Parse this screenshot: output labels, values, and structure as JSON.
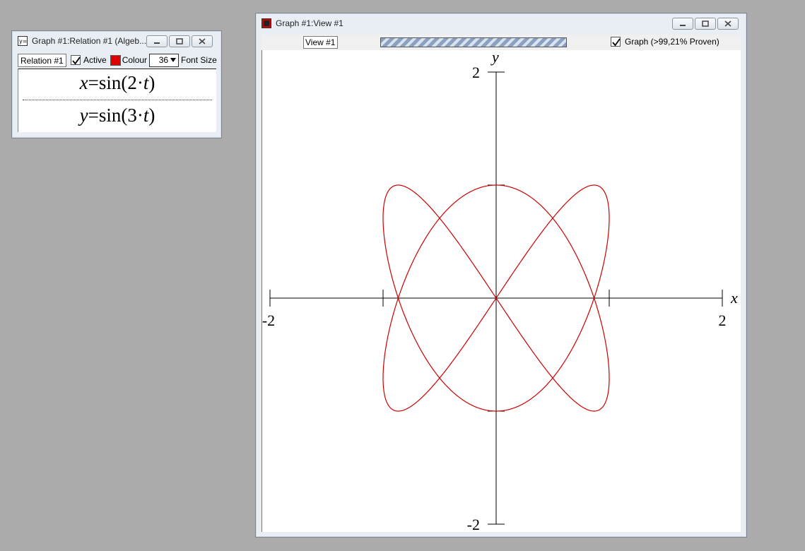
{
  "relation_window": {
    "title": "Graph #1:Relation #1 (Algeb...",
    "relation_name": "Relation #1",
    "active_label": "Active",
    "active_checked": true,
    "colour_label": "Colour",
    "colour_value": "#e00000",
    "font_size_value": "36",
    "font_size_label": "Font Size",
    "equations": [
      {
        "lhs": "x",
        "rhs_prefix": "=sin(2·",
        "rhs_var": "t",
        "rhs_suffix": ")"
      },
      {
        "lhs": "y",
        "rhs_prefix": "=sin(3·",
        "rhs_var": "t",
        "rhs_suffix": ")"
      }
    ]
  },
  "view_window": {
    "title": "Graph #1:View #1",
    "view_name": "View #1",
    "graph_checked": true,
    "graph_status": "Graph (>99,21% Proven)",
    "progress": 1.0
  },
  "chart_data": {
    "type": "line",
    "series": [
      {
        "parametric": true,
        "x_expr": "sin(2*t)",
        "y_expr": "sin(3*t)",
        "t_range": [
          0,
          6.283185
        ],
        "color": "#cc0000"
      }
    ],
    "xlabel": "x",
    "ylabel": "y",
    "xlim": [
      -2,
      2
    ],
    "ylim": [
      -2,
      2
    ],
    "x_ticks": [
      -2,
      -1,
      1,
      2
    ],
    "y_ticks": [
      -2,
      -1,
      1,
      2
    ],
    "x_tick_labels": {
      "min": "-2",
      "max": "2"
    },
    "y_tick_labels": {
      "min": "-2",
      "max": "2"
    },
    "grid": false
  }
}
